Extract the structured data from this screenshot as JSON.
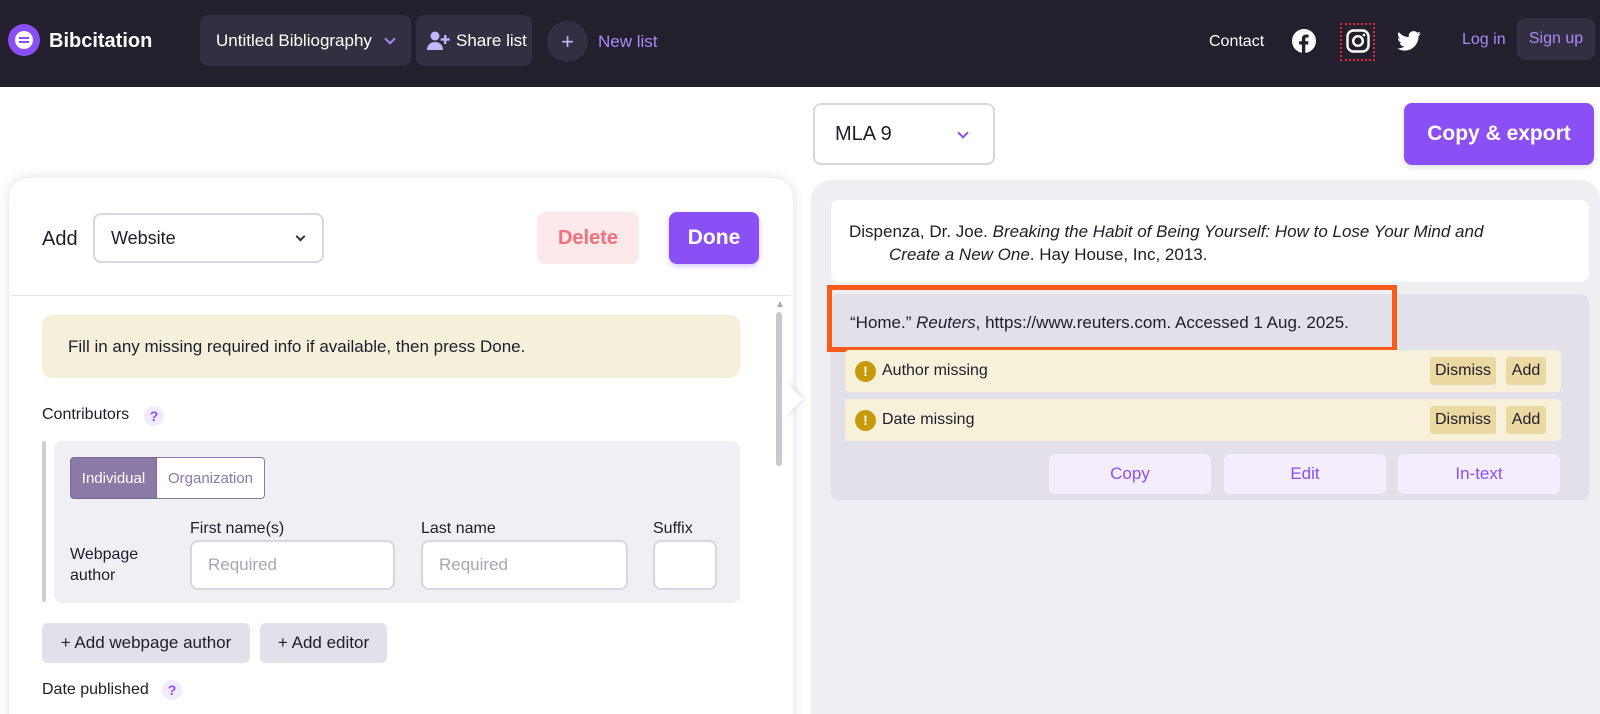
{
  "header": {
    "brand": "Bibcitation",
    "bibliography_title": "Untitled Bibliography",
    "share_label": "Share list",
    "new_list_label": "New list",
    "contact_label": "Contact",
    "login_label": "Log in",
    "signup_label": "Sign up",
    "icons": [
      "user-plus-icon",
      "plus-icon",
      "facebook-icon",
      "instagram-icon",
      "twitter-icon"
    ]
  },
  "toolbar": {
    "citation_style": "MLA 9",
    "copy_export_label": "Copy & export"
  },
  "editor": {
    "add_label": "Add",
    "source_type": "Website",
    "delete_label": "Delete",
    "done_label": "Done",
    "notice": "Fill in any missing required info if available, then press Done.",
    "contributors_label": "Contributors",
    "help_glyph": "?",
    "contributor_type_tabs": [
      "Individual",
      "Organization"
    ],
    "selected_contributor_tab": "Individual",
    "role_label_line1": "Webpage",
    "role_label_line2": "author",
    "first_name_label": "First name(s)",
    "last_name_label": "Last name",
    "suffix_label": "Suffix",
    "first_name_placeholder": "Required",
    "last_name_placeholder": "Required",
    "suffix_value": "",
    "add_author_label": "+ Add webpage author",
    "add_editor_label": "+ Add editor",
    "date_published_label": "Date published"
  },
  "citations": [
    {
      "author": "Dispenza, Dr. Joe. ",
      "title_italic": "Breaking the Habit of Being Yourself: How to Lose Your Mind and",
      "title_italic_cont": "Create a New One",
      "rest": ". Hay House, Inc, 2013."
    },
    {
      "pre": "“Home.” ",
      "site_italic": "Reuters",
      "rest": ", https://www.reuters.com. Accessed 1 Aug. 2025.",
      "warnings": [
        {
          "icon": "!",
          "text": "Author missing",
          "dismiss": "Dismiss",
          "add": "Add"
        },
        {
          "icon": "!",
          "text": "Date missing",
          "dismiss": "Dismiss",
          "add": "Add"
        }
      ],
      "actions": [
        "Copy",
        "Edit",
        "In-text"
      ]
    }
  ],
  "colors": {
    "accent": "#8b4ff6",
    "topbar": "#231f2d",
    "highlight": "#fa5a1a",
    "warning": "#c79a0c"
  }
}
